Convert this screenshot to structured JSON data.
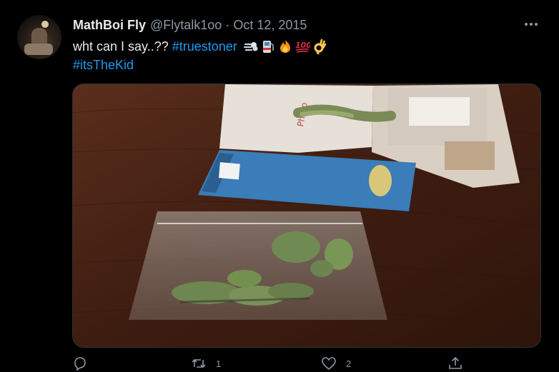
{
  "tweet": {
    "display_name": "MathBoi Fly",
    "handle": "@Flytalk1oo",
    "separator": "·",
    "date": "Oct 12, 2015",
    "text_plain": "wht can I say..?? ",
    "hashtag_1": "#truestoner",
    "emojis": [
      "dash-emoji",
      "fuel-pump-emoji",
      "fire-emoji",
      "hundred-points-emoji",
      "ok-hand-emoji"
    ],
    "hashtag_2": "#itsTheKid",
    "avatar_icon": "user-avatar",
    "more_icon": "more-options-icon",
    "media_description_icon": "photo-media"
  },
  "actions": {
    "reply": {
      "icon": "reply-icon",
      "count": ""
    },
    "retweet": {
      "icon": "retweet-icon",
      "count": "1"
    },
    "like": {
      "icon": "heart-icon",
      "count": "2"
    },
    "share": {
      "icon": "share-icon",
      "count": ""
    }
  },
  "colors": {
    "background": "#000000",
    "text_primary": "#e7e9ea",
    "text_secondary": "#8b98a5",
    "link": "#1d9bf0"
  }
}
